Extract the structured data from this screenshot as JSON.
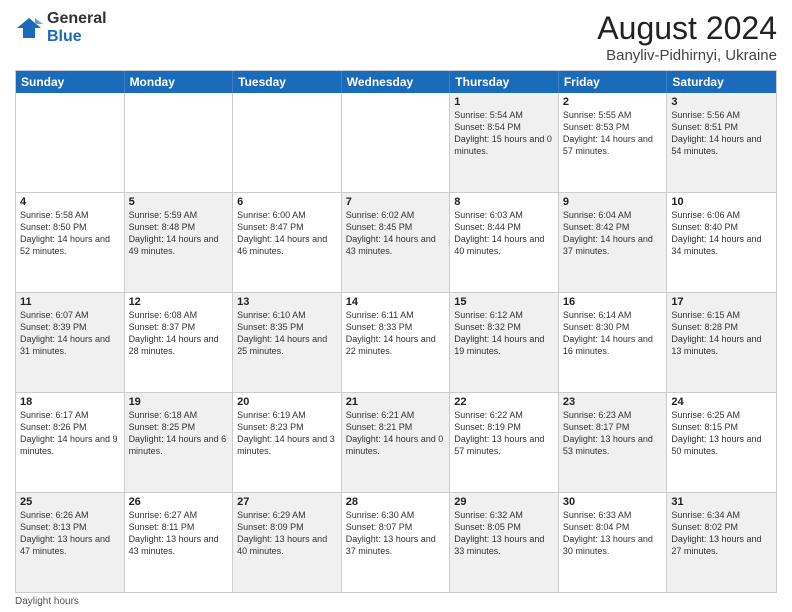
{
  "header": {
    "logo_general": "General",
    "logo_blue": "Blue",
    "main_title": "August 2024",
    "subtitle": "Banyliv-Pidhirnyi, Ukraine"
  },
  "days_of_week": [
    "Sunday",
    "Monday",
    "Tuesday",
    "Wednesday",
    "Thursday",
    "Friday",
    "Saturday"
  ],
  "weeks": [
    [
      {
        "num": "",
        "info": "",
        "shaded": false
      },
      {
        "num": "",
        "info": "",
        "shaded": false
      },
      {
        "num": "",
        "info": "",
        "shaded": false
      },
      {
        "num": "",
        "info": "",
        "shaded": false
      },
      {
        "num": "1",
        "info": "Sunrise: 5:54 AM\nSunset: 8:54 PM\nDaylight: 15 hours and 0 minutes.",
        "shaded": true
      },
      {
        "num": "2",
        "info": "Sunrise: 5:55 AM\nSunset: 8:53 PM\nDaylight: 14 hours and 57 minutes.",
        "shaded": false
      },
      {
        "num": "3",
        "info": "Sunrise: 5:56 AM\nSunset: 8:51 PM\nDaylight: 14 hours and 54 minutes.",
        "shaded": true
      }
    ],
    [
      {
        "num": "4",
        "info": "Sunrise: 5:58 AM\nSunset: 8:50 PM\nDaylight: 14 hours and 52 minutes.",
        "shaded": false
      },
      {
        "num": "5",
        "info": "Sunrise: 5:59 AM\nSunset: 8:48 PM\nDaylight: 14 hours and 49 minutes.",
        "shaded": true
      },
      {
        "num": "6",
        "info": "Sunrise: 6:00 AM\nSunset: 8:47 PM\nDaylight: 14 hours and 46 minutes.",
        "shaded": false
      },
      {
        "num": "7",
        "info": "Sunrise: 6:02 AM\nSunset: 8:45 PM\nDaylight: 14 hours and 43 minutes.",
        "shaded": true
      },
      {
        "num": "8",
        "info": "Sunrise: 6:03 AM\nSunset: 8:44 PM\nDaylight: 14 hours and 40 minutes.",
        "shaded": false
      },
      {
        "num": "9",
        "info": "Sunrise: 6:04 AM\nSunset: 8:42 PM\nDaylight: 14 hours and 37 minutes.",
        "shaded": true
      },
      {
        "num": "10",
        "info": "Sunrise: 6:06 AM\nSunset: 8:40 PM\nDaylight: 14 hours and 34 minutes.",
        "shaded": false
      }
    ],
    [
      {
        "num": "11",
        "info": "Sunrise: 6:07 AM\nSunset: 8:39 PM\nDaylight: 14 hours and 31 minutes.",
        "shaded": true
      },
      {
        "num": "12",
        "info": "Sunrise: 6:08 AM\nSunset: 8:37 PM\nDaylight: 14 hours and 28 minutes.",
        "shaded": false
      },
      {
        "num": "13",
        "info": "Sunrise: 6:10 AM\nSunset: 8:35 PM\nDaylight: 14 hours and 25 minutes.",
        "shaded": true
      },
      {
        "num": "14",
        "info": "Sunrise: 6:11 AM\nSunset: 8:33 PM\nDaylight: 14 hours and 22 minutes.",
        "shaded": false
      },
      {
        "num": "15",
        "info": "Sunrise: 6:12 AM\nSunset: 8:32 PM\nDaylight: 14 hours and 19 minutes.",
        "shaded": true
      },
      {
        "num": "16",
        "info": "Sunrise: 6:14 AM\nSunset: 8:30 PM\nDaylight: 14 hours and 16 minutes.",
        "shaded": false
      },
      {
        "num": "17",
        "info": "Sunrise: 6:15 AM\nSunset: 8:28 PM\nDaylight: 14 hours and 13 minutes.",
        "shaded": true
      }
    ],
    [
      {
        "num": "18",
        "info": "Sunrise: 6:17 AM\nSunset: 8:26 PM\nDaylight: 14 hours and 9 minutes.",
        "shaded": false
      },
      {
        "num": "19",
        "info": "Sunrise: 6:18 AM\nSunset: 8:25 PM\nDaylight: 14 hours and 6 minutes.",
        "shaded": true
      },
      {
        "num": "20",
        "info": "Sunrise: 6:19 AM\nSunset: 8:23 PM\nDaylight: 14 hours and 3 minutes.",
        "shaded": false
      },
      {
        "num": "21",
        "info": "Sunrise: 6:21 AM\nSunset: 8:21 PM\nDaylight: 14 hours and 0 minutes.",
        "shaded": true
      },
      {
        "num": "22",
        "info": "Sunrise: 6:22 AM\nSunset: 8:19 PM\nDaylight: 13 hours and 57 minutes.",
        "shaded": false
      },
      {
        "num": "23",
        "info": "Sunrise: 6:23 AM\nSunset: 8:17 PM\nDaylight: 13 hours and 53 minutes.",
        "shaded": true
      },
      {
        "num": "24",
        "info": "Sunrise: 6:25 AM\nSunset: 8:15 PM\nDaylight: 13 hours and 50 minutes.",
        "shaded": false
      }
    ],
    [
      {
        "num": "25",
        "info": "Sunrise: 6:26 AM\nSunset: 8:13 PM\nDaylight: 13 hours and 47 minutes.",
        "shaded": true
      },
      {
        "num": "26",
        "info": "Sunrise: 6:27 AM\nSunset: 8:11 PM\nDaylight: 13 hours and 43 minutes.",
        "shaded": false
      },
      {
        "num": "27",
        "info": "Sunrise: 6:29 AM\nSunset: 8:09 PM\nDaylight: 13 hours and 40 minutes.",
        "shaded": true
      },
      {
        "num": "28",
        "info": "Sunrise: 6:30 AM\nSunset: 8:07 PM\nDaylight: 13 hours and 37 minutes.",
        "shaded": false
      },
      {
        "num": "29",
        "info": "Sunrise: 6:32 AM\nSunset: 8:05 PM\nDaylight: 13 hours and 33 minutes.",
        "shaded": true
      },
      {
        "num": "30",
        "info": "Sunrise: 6:33 AM\nSunset: 8:04 PM\nDaylight: 13 hours and 30 minutes.",
        "shaded": false
      },
      {
        "num": "31",
        "info": "Sunrise: 6:34 AM\nSunset: 8:02 PM\nDaylight: 13 hours and 27 minutes.",
        "shaded": true
      }
    ]
  ],
  "footer": {
    "note": "Daylight hours"
  }
}
